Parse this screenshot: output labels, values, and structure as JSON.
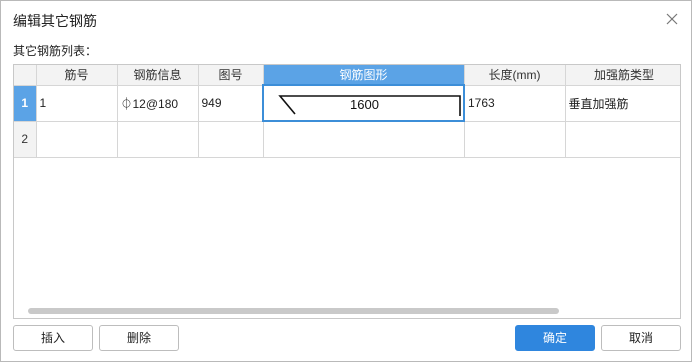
{
  "dialog": {
    "title": "编辑其它钢筋",
    "list_label": "其它钢筋列表："
  },
  "table": {
    "headers": [
      "筋号",
      "钢筋信息",
      "图号",
      "钢筋图形",
      "长度(mm)",
      "加强筋类型"
    ],
    "rows": [
      {
        "num": "1",
        "jinhao": "1",
        "info": "⏀12@180",
        "tuhao": "949",
        "shape_length": "1600",
        "length": "1763",
        "type": "垂直加强筋"
      },
      {
        "num": "2",
        "jinhao": "",
        "info": "",
        "tuhao": "",
        "shape_length": "",
        "length": "",
        "type": ""
      }
    ]
  },
  "buttons": {
    "insert": "插入",
    "delete": "删除",
    "ok": "确定",
    "cancel": "取消"
  },
  "colors": {
    "accent": "#2f86de",
    "header_active": "#5ba3e6"
  }
}
